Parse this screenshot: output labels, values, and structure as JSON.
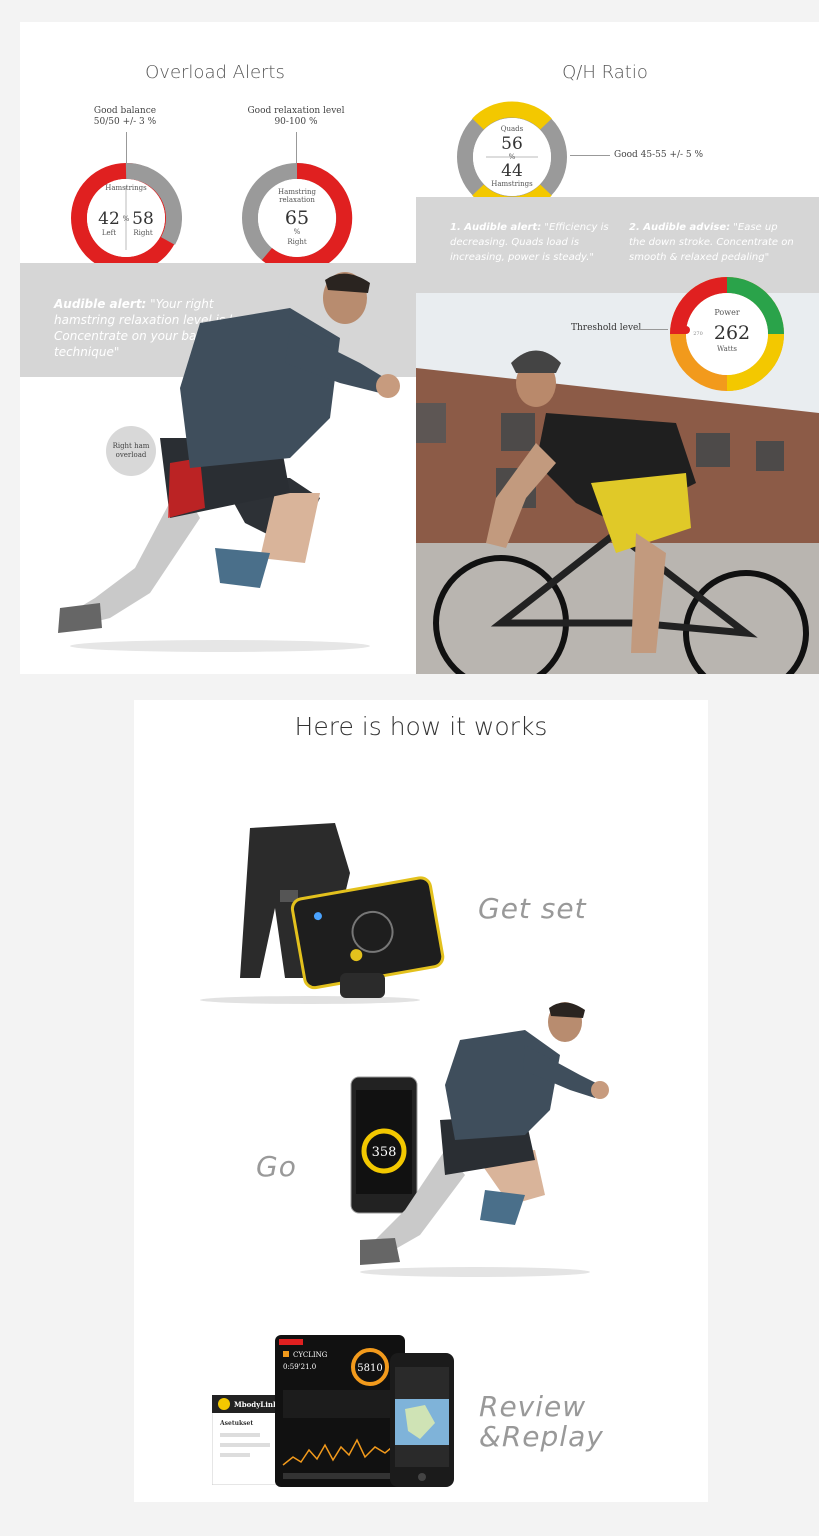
{
  "overload": {
    "title": "Overload Alerts",
    "balance_label": "Good balance",
    "balance_range": "50/50 +/- 3 %",
    "relax_label": "Good relaxation level",
    "relax_range": "90-100 %",
    "gauge1": {
      "label": "Hamstrings",
      "left_value": "42",
      "right_value": "58",
      "sep": "%",
      "left_label": "Left",
      "right_label": "Right"
    },
    "gauge2": {
      "label_line1": "Hamstring",
      "label_line2": "relaxation",
      "value": "65",
      "unit": "%",
      "side": "Right"
    },
    "alert_prefix": "Audible alert:",
    "alert_text": " \"Your right hamstring relaxation level is low. Concentrate on your balance & technique\"",
    "callout": "Right ham overload"
  },
  "qh": {
    "title": "Q/H Ratio",
    "gauge": {
      "top_label": "Quads",
      "top_value": "56",
      "unit": "%",
      "bottom_value": "44",
      "bottom_label": "Hamstrings"
    },
    "good_range": "Good 45-55 +/- 5 %",
    "alert1_prefix": "1. Audible alert:",
    "alert1_text": " \"Efficiency is decreasing. Quads load is increasing, power is steady.\"",
    "alert2_prefix": "2. Audible advise:",
    "alert2_text": " \"Ease up the down stroke. Concentrate on smooth & relaxed pedaling\"",
    "threshold_label": "Threshold level",
    "power": {
      "label": "Power",
      "value": "262",
      "unit": "Watts",
      "threshold": "270"
    }
  },
  "how": {
    "title": "Here is how it works",
    "step1": "Get set",
    "step2": "Go",
    "step3_line1": "Review",
    "step3_line2": "&Replay",
    "phone_value": "358",
    "tablet_activity": "CYCLING",
    "tablet_time": "0:59'21.0",
    "tablet_value": "5810",
    "laptop_brand": "MbodyLink",
    "laptop_heading": "Asetukset"
  },
  "colors": {
    "red": "#e02020",
    "grey": "#9a9a9a",
    "yellow": "#f3c800",
    "green": "#2aa34a",
    "orange": "#f29a1c"
  }
}
